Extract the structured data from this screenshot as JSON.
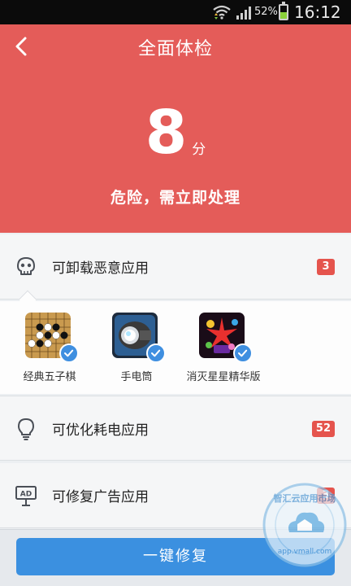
{
  "status_bar": {
    "battery_pct": "52%",
    "time": "16:12"
  },
  "header": {
    "title": "全面体检"
  },
  "score": {
    "value": "8",
    "unit": "分",
    "status": "危险，需立即处理"
  },
  "sections": [
    {
      "label": "可卸载恶意应用",
      "count": "3",
      "icon": "skull-icon"
    },
    {
      "label": "可优化耗电应用",
      "count": "52",
      "icon": "lightbulb-icon"
    },
    {
      "label": "可修复广告应用",
      "count": "3",
      "icon": "ad-sign-icon"
    }
  ],
  "apps": [
    {
      "name": "经典五子棋",
      "icon": "gomoku-app-icon"
    },
    {
      "name": "手电筒",
      "icon": "flashlight-app-icon"
    },
    {
      "name": "消灭星星精华版",
      "icon": "popstar-app-icon"
    }
  ],
  "fix_button": {
    "label": "一键修复"
  },
  "colors": {
    "danger": "#e45c59",
    "accent": "#3b90e0",
    "badge": "#e5544d"
  }
}
